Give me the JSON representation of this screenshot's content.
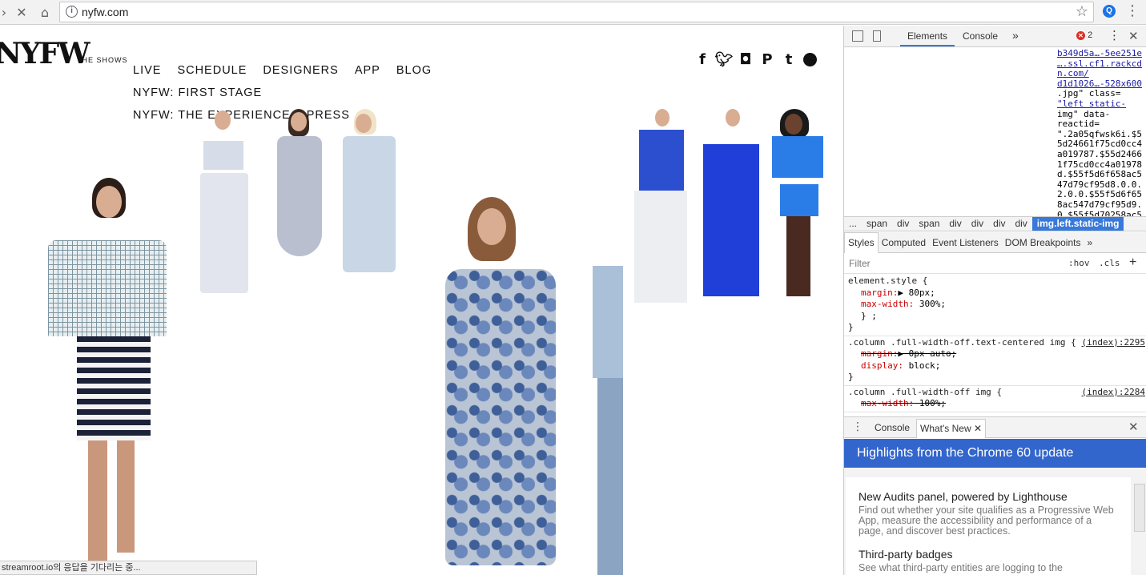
{
  "browser": {
    "url": "nyfw.com",
    "back_icon": "back-arrow-icon",
    "reload_icon": "stop-icon",
    "home_icon": "home-icon"
  },
  "site": {
    "logo_text": "NYFW",
    "logo_sub": "THE SHOWS",
    "nav": [
      "LIVE",
      "SCHEDULE",
      "DESIGNERS",
      "APP",
      "BLOG",
      "NYFW: FIRST STAGE",
      "NYFW: THE EXPERIENCE",
      "PRESS"
    ],
    "social": {
      "facebook": "f",
      "twitter": "t",
      "instagram": "◘",
      "pinterest": "P",
      "tumblr": "t"
    }
  },
  "status_text": "streamroot.io의 응답을 기다리는 중...",
  "devtools": {
    "tabs": [
      "Elements",
      "Console"
    ],
    "more": "»",
    "error_count": "2",
    "elements_lines": [
      "b349d5a…-5ee251e",
      "….ssl.cf1.rackcd",
      "n.com/",
      "d1d1026…-528x600",
      ".jpg\" class=",
      "\"left static-",
      "img\" data-",
      "reactid=",
      "\".2a05qfwsk6i.$5",
      "5d24661f75cd0cc4",
      "a019787.$55d2466",
      "1f75cd0cc4a01978",
      "d.$55f5d6f658ac5",
      "47d79cf95d8.0.0.",
      "2.0.0.$55f5d6f65",
      "8ac547d79cf95d9.",
      "0.$55f5d70258ac5"
    ],
    "breadcrumbs": [
      "...",
      "span",
      "div",
      "span",
      "div",
      "div",
      "div",
      "div",
      "img.left.static-img"
    ],
    "style_tabs": [
      "Styles",
      "Computed",
      "Event Listeners",
      "DOM Breakpoints",
      "»"
    ],
    "filter_placeholder": "Filter",
    "hov": ":hov",
    "cls": ".cls",
    "rules": [
      {
        "selector": "element.style {",
        "source": "",
        "decls": [
          {
            "prop": "margin",
            "value": "▶ 80px;",
            "strike": false
          },
          {
            "prop": "max-width",
            "value": " 300%;",
            "strike": false
          },
          {
            "prop": "",
            "value": "} ;",
            "strike": false
          }
        ],
        "close": "}"
      },
      {
        "selector": ".column .full-width-off.text-centered img {",
        "source": "(index):2295",
        "decls": [
          {
            "prop": "margin",
            "value": "▶ 0px auto;",
            "strike": true
          },
          {
            "prop": "display",
            "value": " block;",
            "strike": false
          }
        ],
        "close": "}"
      },
      {
        "selector": ".column .full-width-off img {",
        "source": "(index):2284",
        "decls": [
          {
            "prop": "max-width",
            "value": " 100%;",
            "strike": true
          }
        ],
        "close": ""
      }
    ],
    "drawer": {
      "tab1": "Console",
      "tab2": "What's New",
      "header": "Highlights from the Chrome 60 update",
      "items": [
        {
          "title": "New Audits panel, powered by Lighthouse",
          "desc": "Find out whether your site qualifies as a Progressive Web App, measure the accessibility and performance of a page, and discover best practices."
        },
        {
          "title": "Third-party badges",
          "desc": "See what third-party entities are logging to the"
        }
      ]
    }
  }
}
